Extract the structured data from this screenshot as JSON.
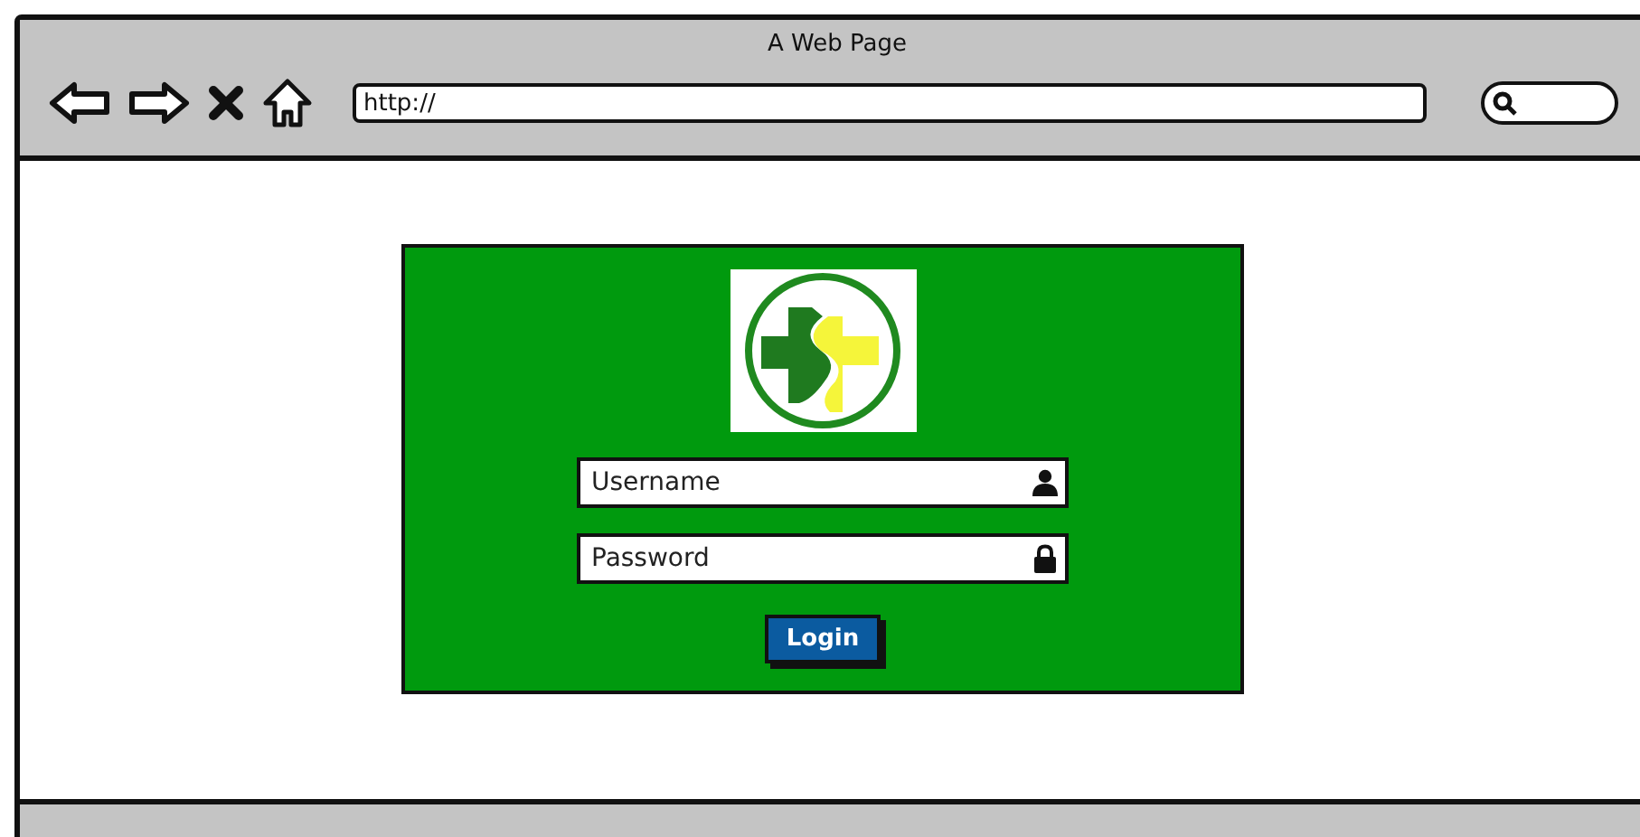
{
  "window": {
    "title": "A Web Page"
  },
  "address_bar": {
    "value": "http://"
  },
  "login": {
    "username": {
      "placeholder": "Username"
    },
    "password": {
      "placeholder": "Password"
    },
    "button": "Login"
  }
}
